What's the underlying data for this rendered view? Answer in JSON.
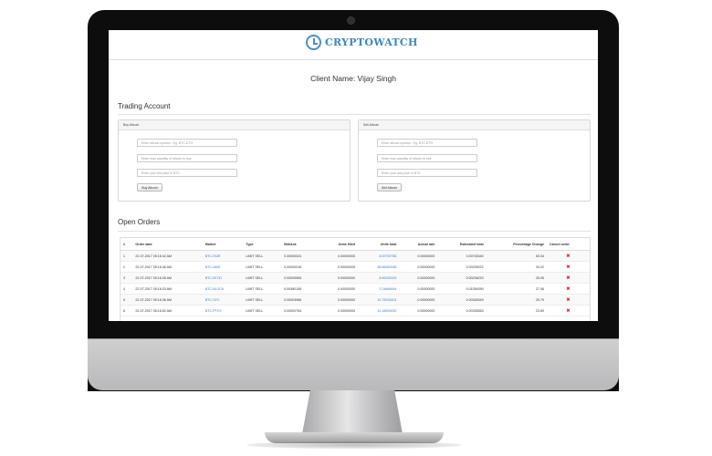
{
  "app": {
    "brand": "CRYPTOWATCH"
  },
  "client": {
    "label": "Client Name: Vijay Singh"
  },
  "trading": {
    "title": "Trading Account",
    "buy": {
      "header": "Buy Altcoin",
      "symbol_placeholder": "Enter altcoin symbol - Eg. BTC-ETH",
      "quantity_placeholder": "Enter max quantity of altcoin to buy",
      "bid_placeholder": "Enter your bid price in BTC",
      "button": "Buy Altcoin"
    },
    "sell": {
      "header": "Sell Altcoin",
      "symbol_placeholder": "Enter altcoin symbol - Eg. BTC-ETH",
      "quantity_placeholder": "Enter max quantity of altcoin to sell",
      "ask_placeholder": "Enter your ask price in BTC",
      "button": "Sell Altcoin"
    }
  },
  "orders": {
    "title": "Open Orders",
    "columns": [
      "#",
      "Order date",
      "Market",
      "Type",
      "Bid/Ask",
      "Units filled",
      "Units total",
      "Actual rate",
      "Estimated total",
      "Percentage Change",
      "Cancel order"
    ],
    "rows": [
      {
        "n": "1",
        "date": "22-07-2017 05:16:42 AM",
        "market": "BTC-FAIR",
        "type": "LIMIT SELL",
        "bid": "0.00000024",
        "filled": "0.00000000",
        "total": "8.52709756",
        "rate": "0.00000000",
        "est": "0.00745340",
        "pct": "60.54"
      },
      {
        "n": "2",
        "date": "22-07-2017 05:16:46 AM",
        "market": "BTC-AMG",
        "type": "LIMIT SELL",
        "bid": "0.00000216",
        "filled": "0.00000000",
        "total": "38.56063936",
        "rate": "0.00000000",
        "est": "0.00239022",
        "pct": "34.22"
      },
      {
        "n": "3",
        "date": "22-07-2017 05:16:35 AM",
        "market": "BTC-BTCD",
        "type": "LIMIT SELL",
        "bid": "0.00009565",
        "filled": "0.00000000",
        "total": "8.89025325",
        "rate": "0.00000000",
        "est": "0.00236220",
        "pct": "25.06"
      },
      {
        "n": "4",
        "date": "22-07-2017 05:16:33 AM",
        "market": "BTC-BLOCK",
        "type": "LIMIT SELL",
        "bid": "0.00480155",
        "filled": "0.00000000",
        "total": "2.24666544",
        "rate": "0.00000000",
        "est": "0.01054090",
        "pct": "27.46"
      },
      {
        "n": "5",
        "date": "22-07-2017 05:16:36 AM",
        "market": "BTC-SYC",
        "type": "LIMIT SELL",
        "bid": "0.00004966",
        "filled": "0.00000000",
        "total": "10.79015424",
        "rate": "0.00000000",
        "est": "0.00345349",
        "pct": "25.79"
      },
      {
        "n": "6",
        "date": "22-07-2017 05:16:52 AM",
        "market": "BTC-PTOY",
        "type": "LIMIT SELL",
        "bid": "0.00000754",
        "filled": "0.00000000",
        "total": "31.18902632",
        "rate": "0.00000000",
        "est": "0.00335563",
        "pct": "23.69"
      }
    ],
    "cancel_symbol": "✖"
  },
  "colors": {
    "accent": "#3b87c4",
    "link": "#3b7dc4",
    "cancel": "#d9302c"
  }
}
